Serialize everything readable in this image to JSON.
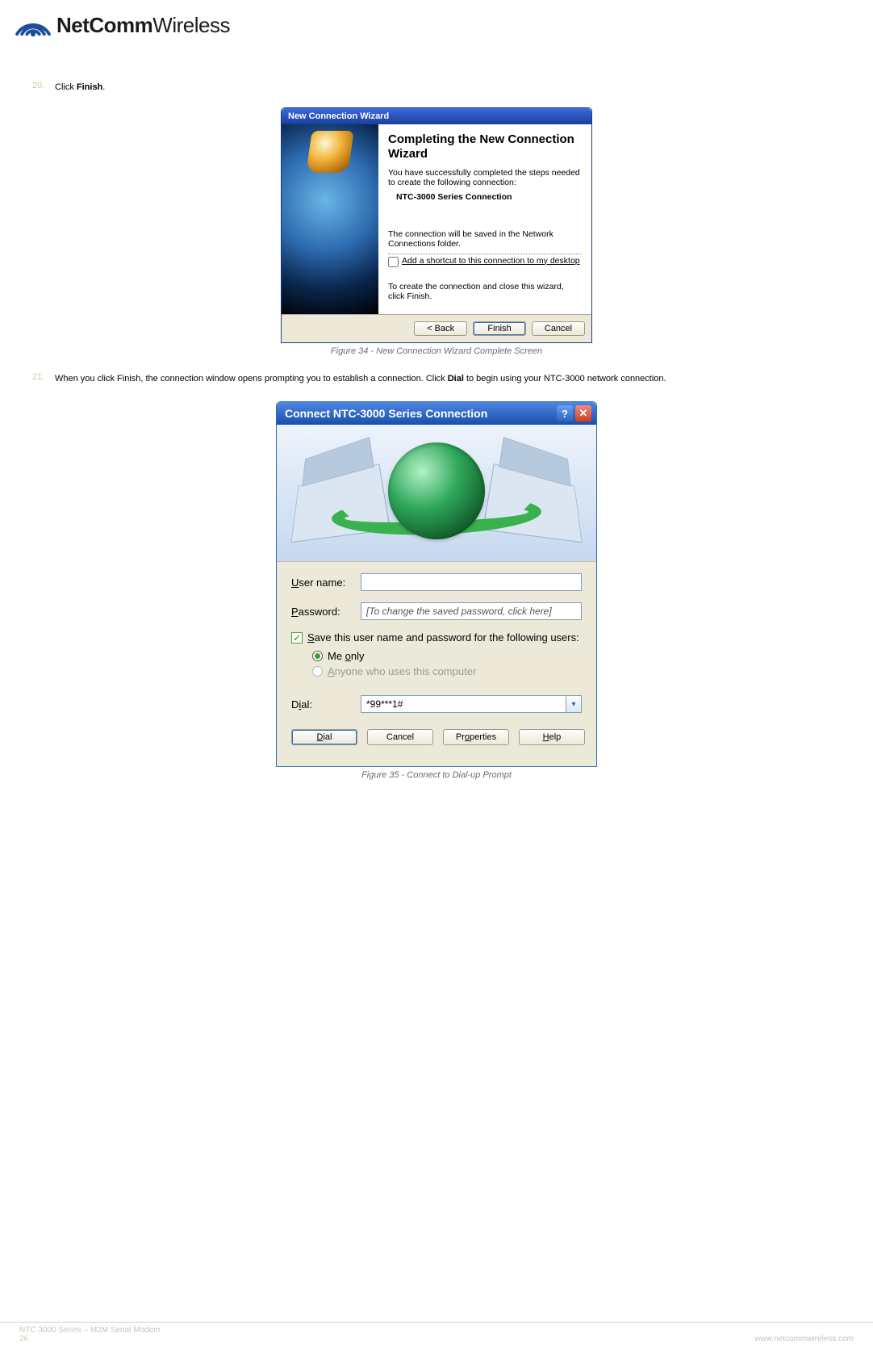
{
  "brand": {
    "name_bold": "NetComm",
    "name_light": "Wireless"
  },
  "steps": [
    {
      "num": "20.",
      "text_plain": "Click ",
      "text_bold": "Finish",
      "text_tail": "."
    },
    {
      "num": "21.",
      "text_plain": "When you click Finish, the connection window opens prompting you to establish a connection. Click ",
      "text_bold": "Dial",
      "text_tail": " to begin using your NTC-3000 network connection."
    }
  ],
  "figure34": {
    "window_title": "New Connection Wizard",
    "heading": "Completing the New Connection Wizard",
    "p1": "You have successfully completed the steps needed to create the following connection:",
    "conn_name": "NTC-3000 Series Connection",
    "p2": "The connection will be saved in the Network Connections folder.",
    "checkbox_label": "Add a shortcut to this connection to my desktop",
    "p3": "To create the connection and close this wizard, click Finish.",
    "buttons": {
      "back": "< Back",
      "finish": "Finish",
      "cancel": "Cancel"
    },
    "caption": "Figure 34 - New Connection Wizard Complete Screen"
  },
  "figure35": {
    "window_title": "Connect NTC-3000 Series Connection",
    "labels": {
      "username": "User name:",
      "username_u": "U",
      "password": "Password:",
      "password_u": "P",
      "dial": "Dial:",
      "dial_u": "i"
    },
    "username_value": "",
    "password_placeholder": "[To change the saved password, click here]",
    "save_chk": "Save this user name and password for the following users:",
    "save_chk_u": "S",
    "radio_me": "Me only",
    "radio_me_u": "o",
    "radio_anyone": "Anyone who uses this computer",
    "radio_anyone_u": "A",
    "dial_value": "*99***1#",
    "buttons": {
      "dial": "Dial",
      "dial_u": "D",
      "cancel": "Cancel",
      "properties": "Properties",
      "properties_u": "o",
      "help": "Help",
      "help_u": "H"
    },
    "caption": "Figure 35 - Connect to Dial-up Prompt"
  },
  "footer": {
    "line1": "NTC 3000 Series – M2M Serial Modem",
    "page": "26",
    "url": "www.netcommwireless.com"
  }
}
